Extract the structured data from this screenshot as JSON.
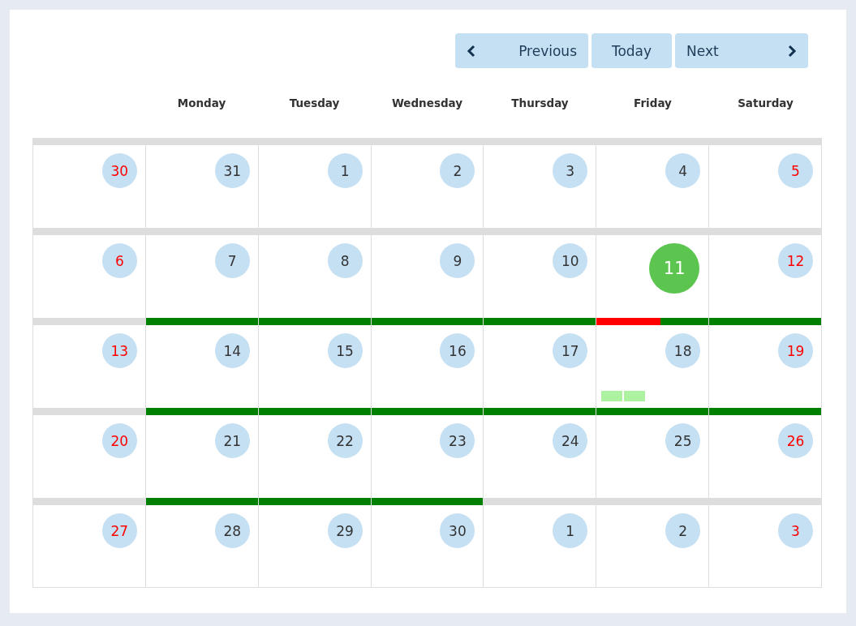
{
  "toolbar": {
    "buttons": [
      {
        "kind": "previous",
        "label": "Previous"
      },
      {
        "kind": "today",
        "label": "Today"
      },
      {
        "kind": "next",
        "label": "Next"
      }
    ]
  },
  "weekdays": [
    "Monday",
    "Tuesday",
    "Wednesday",
    "Thursday",
    "Friday",
    "Saturday"
  ],
  "weeks": [
    {
      "days": [
        {
          "number": "30",
          "weekend": true,
          "today": false,
          "color": "#dddddd"
        },
        {
          "number": "31",
          "weekend": false,
          "today": false,
          "color": "#dddddd"
        },
        {
          "number": "1",
          "weekend": false,
          "today": false,
          "color": "#dddddd"
        },
        {
          "number": "2",
          "weekend": false,
          "today": false,
          "color": "#dddddd"
        },
        {
          "number": "3",
          "weekend": false,
          "today": false,
          "color": "#dddddd"
        },
        {
          "number": "4",
          "weekend": false,
          "today": false,
          "color": "#dddddd"
        },
        {
          "number": "5",
          "weekend": true,
          "today": false,
          "color": "#dddddd"
        }
      ]
    },
    {
      "days": [
        {
          "number": "6",
          "weekend": true,
          "today": false,
          "color": "#dddddd"
        },
        {
          "number": "7",
          "weekend": false,
          "today": false,
          "color": "#dddddd"
        },
        {
          "number": "8",
          "weekend": false,
          "today": false,
          "color": "#dddddd"
        },
        {
          "number": "9",
          "weekend": false,
          "today": false,
          "color": "#dddddd"
        },
        {
          "number": "10",
          "weekend": false,
          "today": false,
          "color": "#dddddd"
        },
        {
          "number": "11",
          "weekend": false,
          "today": true,
          "color": "#dddddd"
        },
        {
          "number": "12",
          "weekend": true,
          "today": false,
          "color": "#dddddd"
        }
      ]
    },
    {
      "days": [
        {
          "number": "13",
          "weekend": true,
          "today": false,
          "color": "#dddddd"
        },
        {
          "number": "14",
          "weekend": false,
          "today": false,
          "color": "#008000"
        },
        {
          "number": "15",
          "weekend": false,
          "today": false,
          "color": "#008000"
        },
        {
          "number": "16",
          "weekend": false,
          "today": false,
          "color": "#008000"
        },
        {
          "number": "17",
          "weekend": false,
          "today": false,
          "color": "#008000"
        },
        {
          "number": "18",
          "weekend": false,
          "today": false,
          "color": "#008000",
          "alert": {
            "color": "#ff0000",
            "level": 0.57
          },
          "markers": [
            {
              "color": "#adf2a0"
            },
            {
              "color": "#adf2a0"
            }
          ]
        },
        {
          "number": "19",
          "weekend": true,
          "today": false,
          "color": "#008000"
        }
      ]
    },
    {
      "days": [
        {
          "number": "20",
          "weekend": true,
          "today": false,
          "color": "#dddddd"
        },
        {
          "number": "21",
          "weekend": false,
          "today": false,
          "color": "#008000"
        },
        {
          "number": "22",
          "weekend": false,
          "today": false,
          "color": "#008000"
        },
        {
          "number": "23",
          "weekend": false,
          "today": false,
          "color": "#008000"
        },
        {
          "number": "24",
          "weekend": false,
          "today": false,
          "color": "#008000"
        },
        {
          "number": "25",
          "weekend": false,
          "today": false,
          "color": "#008000"
        },
        {
          "number": "26",
          "weekend": true,
          "today": false,
          "color": "#008000"
        }
      ]
    },
    {
      "days": [
        {
          "number": "27",
          "weekend": true,
          "today": false,
          "color": "#dddddd"
        },
        {
          "number": "28",
          "weekend": false,
          "today": false,
          "color": "#008000"
        },
        {
          "number": "29",
          "weekend": false,
          "today": false,
          "color": "#008000"
        },
        {
          "number": "30",
          "weekend": false,
          "today": false,
          "color": "#008000"
        },
        {
          "number": "1",
          "weekend": false,
          "today": false,
          "color": "#dddddd"
        },
        {
          "number": "2",
          "weekend": false,
          "today": false,
          "color": "#dddddd"
        },
        {
          "number": "3",
          "weekend": true,
          "today": false,
          "color": "#dddddd"
        }
      ]
    }
  ]
}
